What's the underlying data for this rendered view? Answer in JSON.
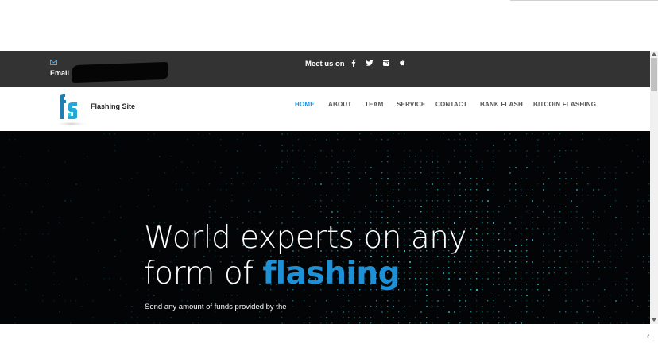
{
  "topbar": {
    "email_label": "Email",
    "meet_label": "Meet us on",
    "social": [
      {
        "icon": "facebook-icon",
        "glyph": "f"
      },
      {
        "icon": "twitter-icon",
        "glyph": "t"
      },
      {
        "icon": "instagram-icon",
        "glyph": "i"
      },
      {
        "icon": "apple-icon",
        "glyph": "a"
      }
    ]
  },
  "navbar": {
    "site_name": "Flashing Site",
    "items": [
      {
        "label": "HOME",
        "active": true
      },
      {
        "label": "ABOUT",
        "active": false
      },
      {
        "label": "TEAM",
        "active": false
      },
      {
        "label": "SERVICE",
        "active": false
      },
      {
        "label": "CONTACT",
        "active": false
      },
      {
        "label": "BANK FLASH",
        "active": false
      },
      {
        "label": "BITCOIN FLASHING",
        "active": false
      }
    ]
  },
  "hero": {
    "headline_line1": "World experts on any",
    "headline_line2_prefix": "form of ",
    "headline_line2_accent": "flashing",
    "subtext": "Send any amount of funds provided by the"
  },
  "colors": {
    "topbar_bg": "#333333",
    "accent": "#1e90d6",
    "hero_bg": "#020405",
    "dots": "#2ec9d8"
  }
}
